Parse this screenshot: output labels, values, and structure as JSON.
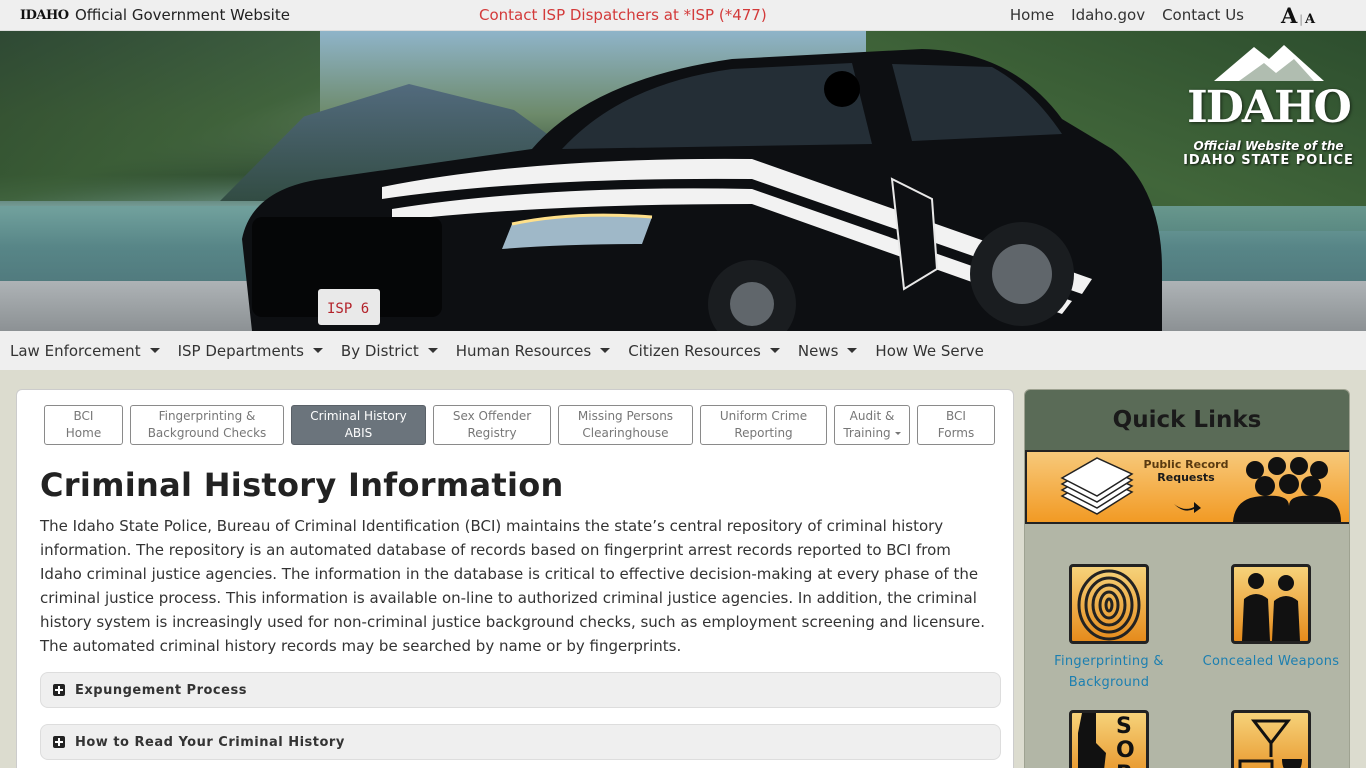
{
  "topbar": {
    "wordmark": "IDAHO",
    "gov_label": "Official Government Website",
    "dispatch": "Contact ISP Dispatchers at *ISP (*477)",
    "links": [
      "Home",
      "Idaho.gov",
      "Contact Us"
    ],
    "font_large": "A",
    "font_sep": "|",
    "font_small": "A"
  },
  "hero": {
    "brand_idaho": "IDAHO",
    "brand_official": "Official Website of the",
    "brand_isp": "IDAHO STATE POLICE"
  },
  "nav": [
    {
      "label": "Law Enforcement",
      "dropdown": true
    },
    {
      "label": "ISP Departments",
      "dropdown": true
    },
    {
      "label": "By District",
      "dropdown": true
    },
    {
      "label": "Human Resources",
      "dropdown": true
    },
    {
      "label": "Citizen Resources",
      "dropdown": true
    },
    {
      "label": "News",
      "dropdown": true
    },
    {
      "label": "How We Serve",
      "dropdown": false
    }
  ],
  "tabs": [
    {
      "line1": "BCI",
      "line2": "Home",
      "active": false
    },
    {
      "line1": "Fingerprinting &",
      "line2": "Background Checks",
      "active": false
    },
    {
      "line1": "Criminal History",
      "line2": "ABIS",
      "active": true
    },
    {
      "line1": "Sex Offender",
      "line2": "Registry",
      "active": false
    },
    {
      "line1": "Missing Persons",
      "line2": "Clearinghouse",
      "active": false
    },
    {
      "line1": "Uniform Crime",
      "line2": "Reporting",
      "active": false
    },
    {
      "line1": "Audit &",
      "line2": "Training",
      "active": false
    },
    {
      "line1": "BCI",
      "line2": "Forms",
      "active": false
    }
  ],
  "main": {
    "title": "Criminal History Information",
    "intro": "The Idaho State Police, Bureau of Criminal Identification (BCI) maintains the state’s central repository of criminal history information. The repository is an automated database of records based on fingerprint arrest records reported to BCI from Idaho criminal justice agencies. The information in the database is critical to effective decision-making at every phase of the criminal justice process. This information is available on-line to authorized criminal justice agencies. In addition, the criminal history system is increasingly used for non-criminal justice background checks, such as employment screening and licensure. The automated criminal history records may be searched by name or by fingerprints.",
    "accordions": [
      "Expungement Process",
      "How to Read Your Criminal History"
    ]
  },
  "sidebar": {
    "title": "Quick Links",
    "banner_line1": "Public Record",
    "banner_line2": "Requests",
    "tiles": [
      {
        "label_line1": "Fingerprinting &",
        "label_line2": "Background",
        "icon": "fingerprint-icon"
      },
      {
        "label_line1": "Concealed Weapons",
        "label_line2": "",
        "icon": "silhouette-icon"
      }
    ]
  },
  "colors": {
    "dispatch": "#d33a3a",
    "active_tab": "#6b747c",
    "link": "#1c7fb0",
    "sidebar_head": "#5a6b57",
    "banner_orange": "#f29a24"
  }
}
